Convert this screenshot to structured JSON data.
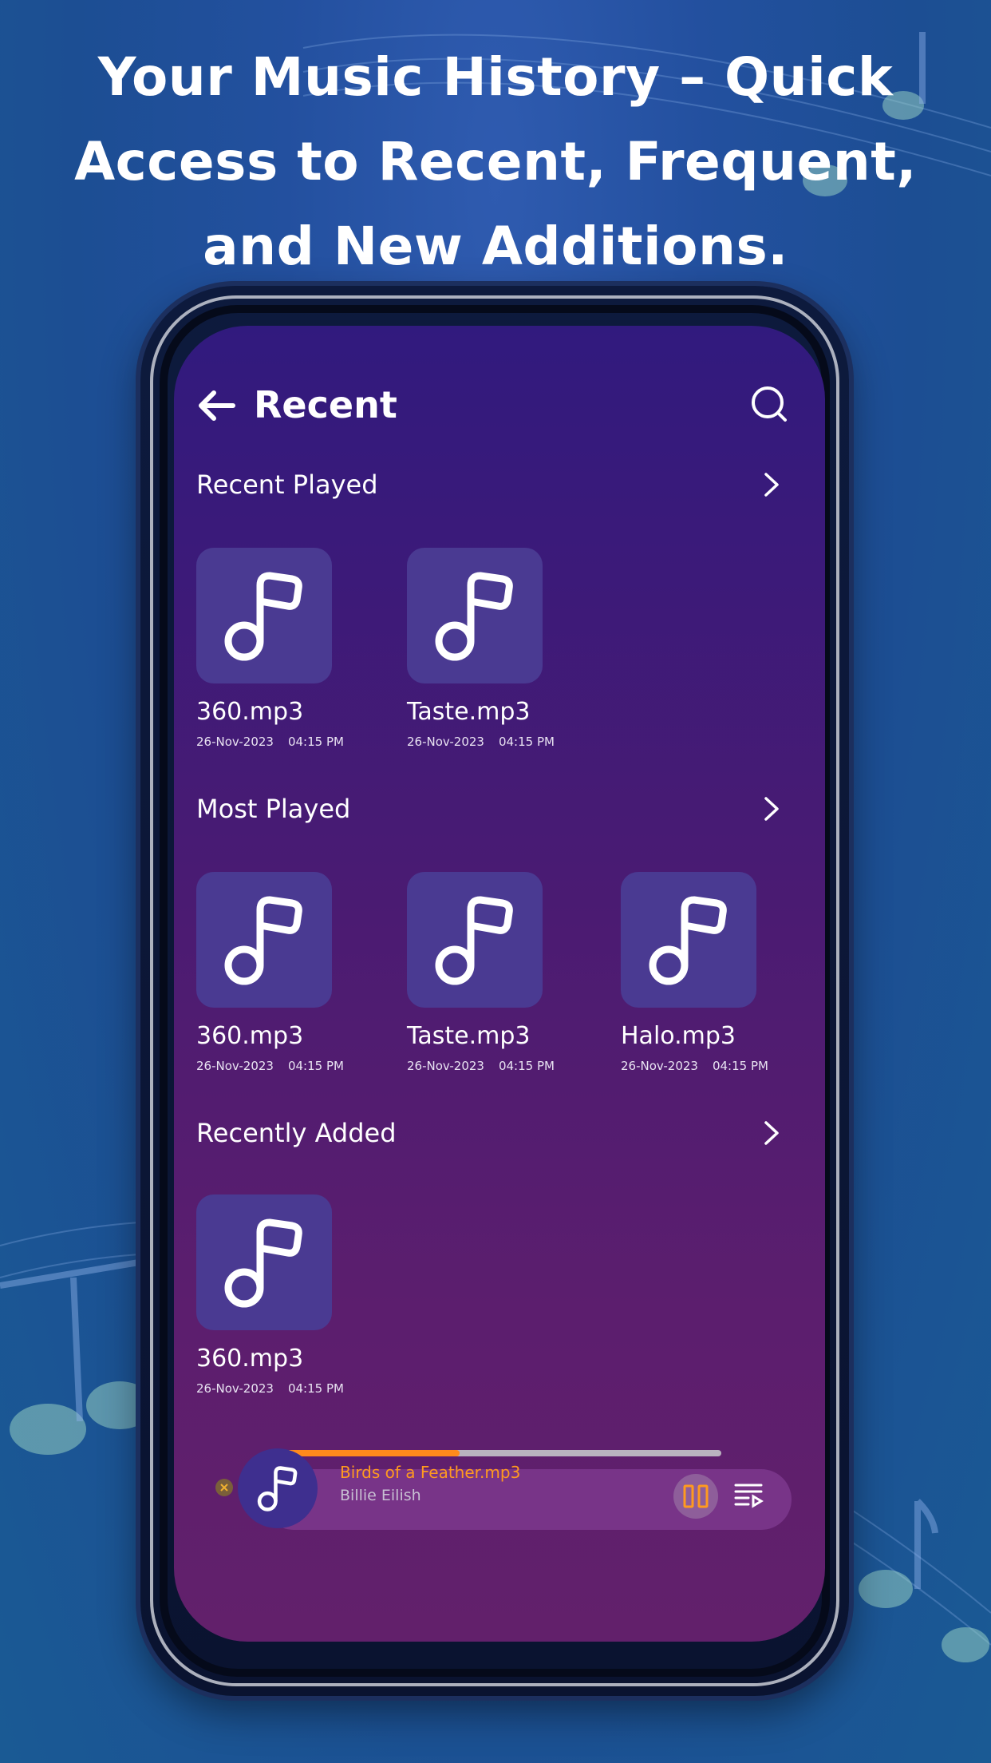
{
  "headline": {
    "line1": "Your Music History – Quick",
    "line2": "Access to Recent, Frequent,",
    "line3": "and New Additions."
  },
  "header": {
    "title": "Recent",
    "back_icon": "arrow-left-icon",
    "search_icon": "search-icon"
  },
  "sections": [
    {
      "title": "Recent Played",
      "items": [
        {
          "name": "360.mp3",
          "date": "26-Nov-2023",
          "time": "04:15 PM"
        },
        {
          "name": "Taste.mp3",
          "date": "26-Nov-2023",
          "time": "04:15 PM"
        }
      ]
    },
    {
      "title": "Most Played",
      "items": [
        {
          "name": "360.mp3",
          "date": "26-Nov-2023",
          "time": "04:15 PM"
        },
        {
          "name": "Taste.mp3",
          "date": "26-Nov-2023",
          "time": "04:15 PM"
        },
        {
          "name": "Halo.mp3",
          "date": "26-Nov-2023",
          "time": "04:15 PM"
        }
      ]
    },
    {
      "title": "Recently Added",
      "items": [
        {
          "name": "360.mp3",
          "date": "26-Nov-2023",
          "time": "04:15 PM"
        }
      ]
    }
  ],
  "player": {
    "song": "Birds of a Feather.mp3",
    "artist": "Billie Eilish",
    "progress": 0.41,
    "state": "playing"
  },
  "colors": {
    "accent": "#ff8a1c",
    "tile": "#4a3a92",
    "screen_top": "#311a7e",
    "screen_bottom": "#62206b"
  }
}
